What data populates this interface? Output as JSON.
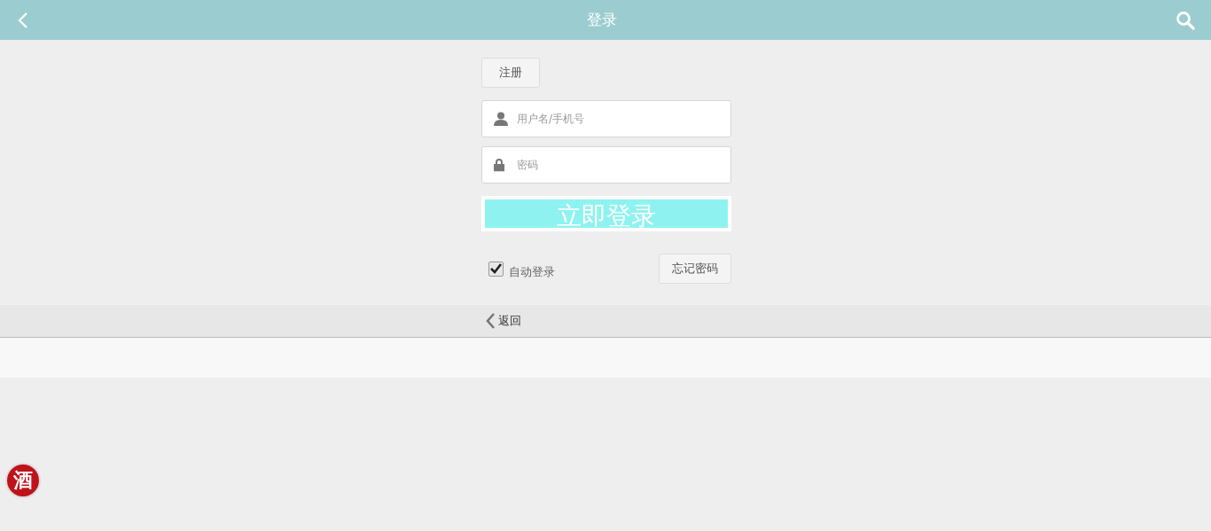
{
  "header": {
    "title": "登录"
  },
  "register_button": "注册",
  "username_field": {
    "placeholder": "用户名/手机号"
  },
  "password_field": {
    "placeholder": "密码"
  },
  "login_button": "立即登录",
  "auto_login": {
    "label": "自动登录",
    "checked": true
  },
  "forgot_button": "忘记密码",
  "back_link": "返回",
  "logo": "酒"
}
